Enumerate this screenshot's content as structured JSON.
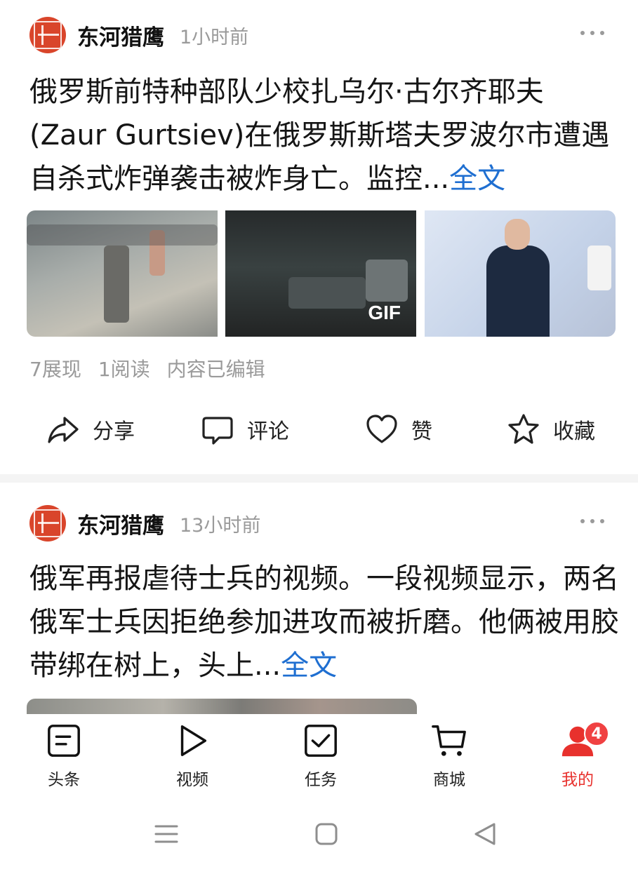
{
  "posts": [
    {
      "author": "东河猎鹰",
      "time": "1小时前",
      "text": "俄罗斯前特种部队少校扎乌尔·古尔齐耶夫(Zaur Gurtsiev)在俄罗斯斯塔夫罗波尔市遭遇自杀式炸弹袭击被炸身亡。监控...",
      "fulltext_link": "全文",
      "images": [
        {
          "icon": "surveillance-video-frame"
        },
        {
          "icon": "night-street-frame",
          "badge": "GIF"
        },
        {
          "icon": "officer-portrait-photo"
        }
      ],
      "meta": {
        "impressions": "7展现",
        "reads": "1阅读",
        "edited": "内容已编辑"
      },
      "actions": {
        "share": "分享",
        "comment": "评论",
        "like": "赞",
        "favorite": "收藏"
      }
    },
    {
      "author": "东河猎鹰",
      "time": "13小时前",
      "text": "俄军再报虐待士兵的视频。一段视频显示，两名俄军士兵因拒绝参加进攻而被折磨。他俩被用胶带绑在树上，头上...",
      "fulltext_link": "全文"
    }
  ],
  "tabbar": {
    "items": [
      {
        "label": "头条",
        "icon": "article-icon"
      },
      {
        "label": "视频",
        "icon": "play-icon"
      },
      {
        "label": "任务",
        "icon": "checkbox-icon"
      },
      {
        "label": "商城",
        "icon": "cart-icon"
      },
      {
        "label": "我的",
        "icon": "user-icon",
        "badge": "4",
        "active": true
      }
    ]
  },
  "colors": {
    "accent": "#e8312d",
    "link": "#1f6fd1",
    "muted": "#9a9a9a",
    "avatar": "#d9452b"
  }
}
